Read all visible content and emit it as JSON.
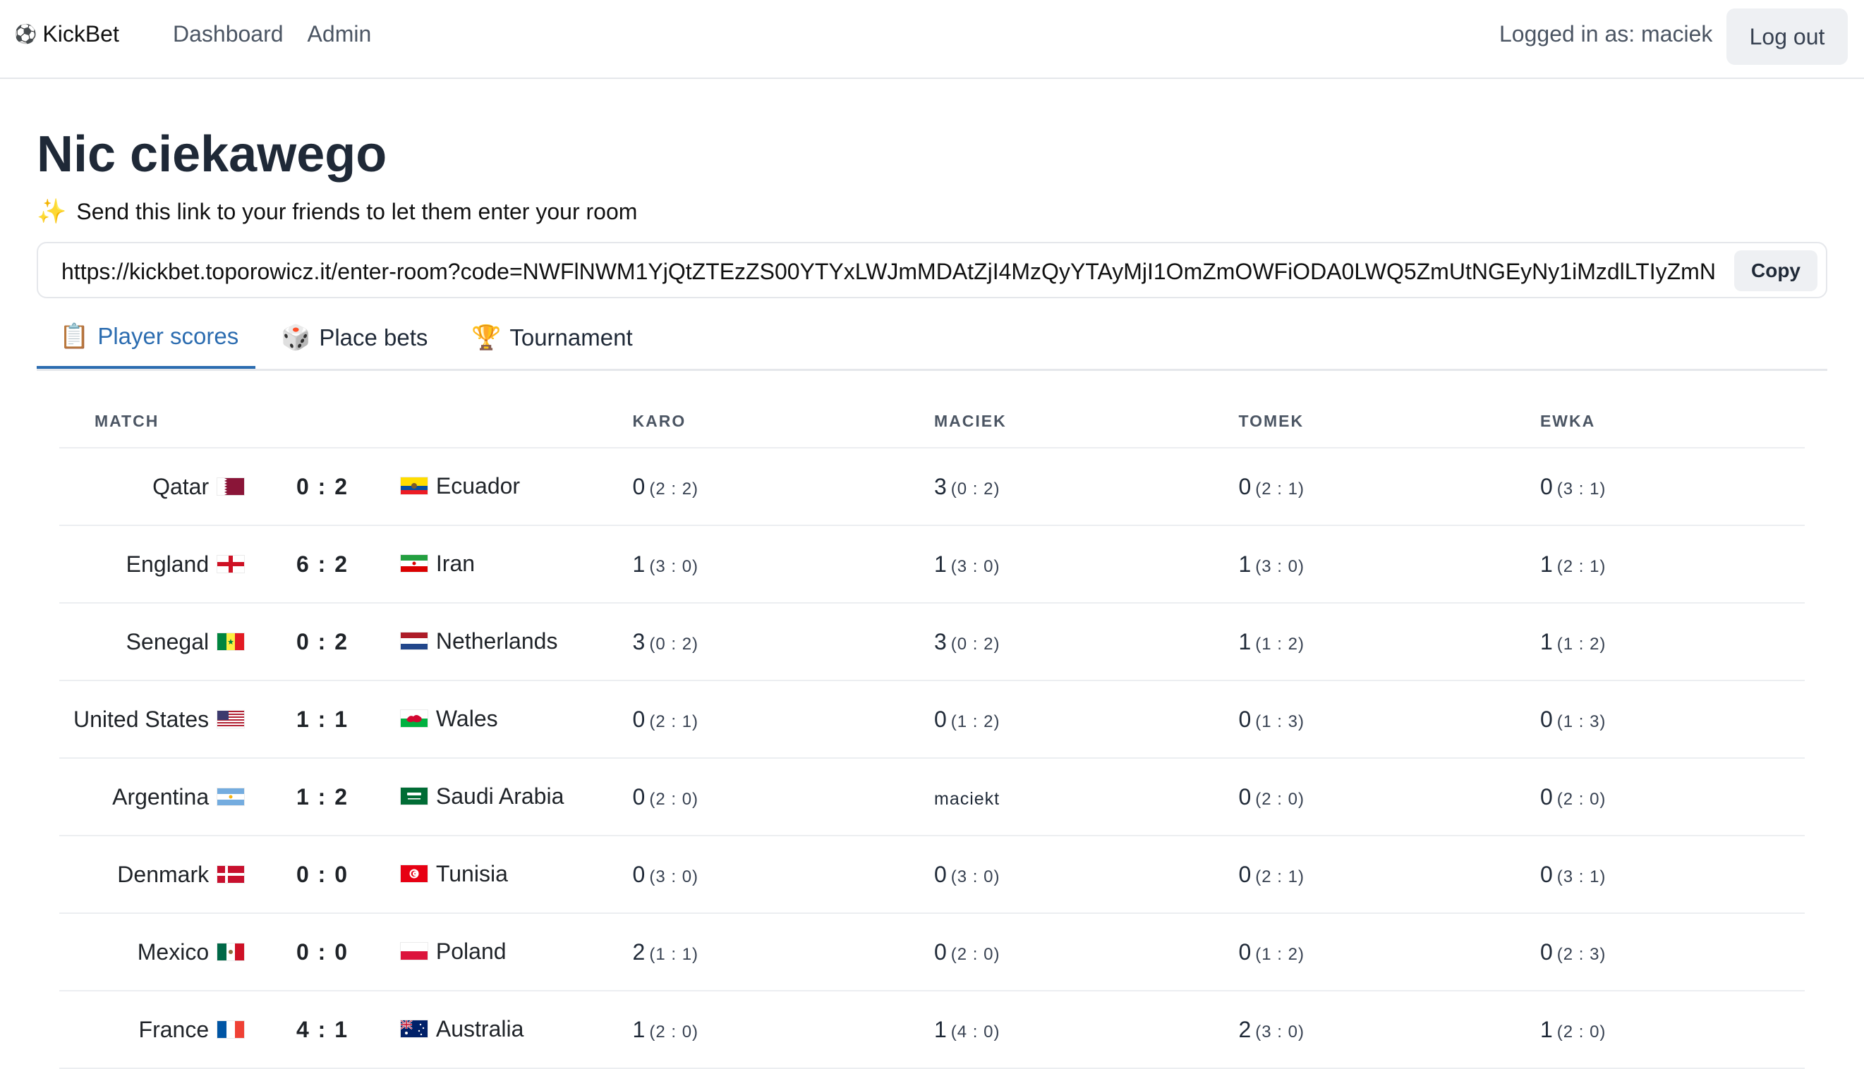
{
  "header": {
    "brand_icon": "soccer-ball-icon",
    "brand": "KickBet",
    "nav": [
      "Dashboard",
      "Admin"
    ],
    "user_label": "Logged in as: maciek",
    "logout_label": "Log out"
  },
  "room": {
    "title": "Nic ciekawego",
    "hint_icon": "sparkles-icon",
    "hint": "Send this link to your friends to let them enter your room",
    "invite_link": "https://kickbet.toporowicz.it/enter-room?code=NWFlNWM1YjQtZTEzZS00YTYxLWJmMDAtZjI4MzQyYTAyMjI1OmZmOWFiODA0LWQ5ZmUtNGEyNy1iMzdlLTIyZmN",
    "copy_label": "Copy"
  },
  "tabs": [
    {
      "icon": "clipboard-icon",
      "glyph": "📋",
      "label": "Player scores",
      "active": true
    },
    {
      "icon": "dice-icon",
      "glyph": "🎲",
      "label": "Place bets",
      "active": false
    },
    {
      "icon": "trophy-icon",
      "glyph": "🏆",
      "label": "Tournament",
      "active": false
    }
  ],
  "table": {
    "columns": [
      "MATCH",
      "KARO",
      "MACIEK",
      "TOMEK",
      "EWKA"
    ],
    "rows": [
      {
        "home": "Qatar",
        "home_flag": "qatar-flag-icon",
        "score": "0 : 2",
        "away": "Ecuador",
        "away_flag": "ecuador-flag-icon",
        "players": [
          {
            "pts": "0",
            "bet": "(2 : 2)"
          },
          {
            "pts": "3",
            "bet": "(0 : 2)"
          },
          {
            "pts": "0",
            "bet": "(2 : 1)"
          },
          {
            "pts": "0",
            "bet": "(3 : 1)"
          }
        ]
      },
      {
        "home": "England",
        "home_flag": "england-flag-icon",
        "score": "6 : 2",
        "away": "Iran",
        "away_flag": "iran-flag-icon",
        "players": [
          {
            "pts": "1",
            "bet": "(3 : 0)"
          },
          {
            "pts": "1",
            "bet": "(3 : 0)"
          },
          {
            "pts": "1",
            "bet": "(3 : 0)"
          },
          {
            "pts": "1",
            "bet": "(2 : 1)"
          }
        ]
      },
      {
        "home": "Senegal",
        "home_flag": "senegal-flag-icon",
        "score": "0 : 2",
        "away": "Netherlands",
        "away_flag": "netherlands-flag-icon",
        "players": [
          {
            "pts": "3",
            "bet": "(0 : 2)"
          },
          {
            "pts": "3",
            "bet": "(0 : 2)"
          },
          {
            "pts": "1",
            "bet": "(1 : 2)"
          },
          {
            "pts": "1",
            "bet": "(1 : 2)"
          }
        ]
      },
      {
        "home": "United States",
        "home_flag": "usa-flag-icon",
        "score": "1 : 1",
        "away": "Wales",
        "away_flag": "wales-flag-icon",
        "players": [
          {
            "pts": "0",
            "bet": "(2 : 1)"
          },
          {
            "pts": "0",
            "bet": "(1 : 2)"
          },
          {
            "pts": "0",
            "bet": "(1 : 3)"
          },
          {
            "pts": "0",
            "bet": "(1 : 3)"
          }
        ]
      },
      {
        "home": "Argentina",
        "home_flag": "argentina-flag-icon",
        "score": "1 : 2",
        "away": "Saudi Arabia",
        "away_flag": "saudi-arabia-flag-icon",
        "players": [
          {
            "pts": "0",
            "bet": "(2 : 0)"
          },
          {
            "text": "maciekt"
          },
          {
            "pts": "0",
            "bet": "(2 : 0)"
          },
          {
            "pts": "0",
            "bet": "(2 : 0)"
          }
        ]
      },
      {
        "home": "Denmark",
        "home_flag": "denmark-flag-icon",
        "score": "0 : 0",
        "away": "Tunisia",
        "away_flag": "tunisia-flag-icon",
        "players": [
          {
            "pts": "0",
            "bet": "(3 : 0)"
          },
          {
            "pts": "0",
            "bet": "(3 : 0)"
          },
          {
            "pts": "0",
            "bet": "(2 : 1)"
          },
          {
            "pts": "0",
            "bet": "(3 : 1)"
          }
        ]
      },
      {
        "home": "Mexico",
        "home_flag": "mexico-flag-icon",
        "score": "0 : 0",
        "away": "Poland",
        "away_flag": "poland-flag-icon",
        "players": [
          {
            "pts": "2",
            "bet": "(1 : 1)"
          },
          {
            "pts": "0",
            "bet": "(2 : 0)"
          },
          {
            "pts": "0",
            "bet": "(1 : 2)"
          },
          {
            "pts": "0",
            "bet": "(2 : 3)"
          }
        ]
      },
      {
        "home": "France",
        "home_flag": "france-flag-icon",
        "score": "4 : 1",
        "away": "Australia",
        "away_flag": "australia-flag-icon",
        "players": [
          {
            "pts": "1",
            "bet": "(2 : 0)"
          },
          {
            "pts": "1",
            "bet": "(4 : 0)"
          },
          {
            "pts": "2",
            "bet": "(3 : 0)"
          },
          {
            "pts": "1",
            "bet": "(2 : 0)"
          }
        ]
      }
    ]
  },
  "colors": {
    "accent": "#2b6cb0",
    "border": "#e5e7eb",
    "button_bg": "#eef0f3"
  }
}
